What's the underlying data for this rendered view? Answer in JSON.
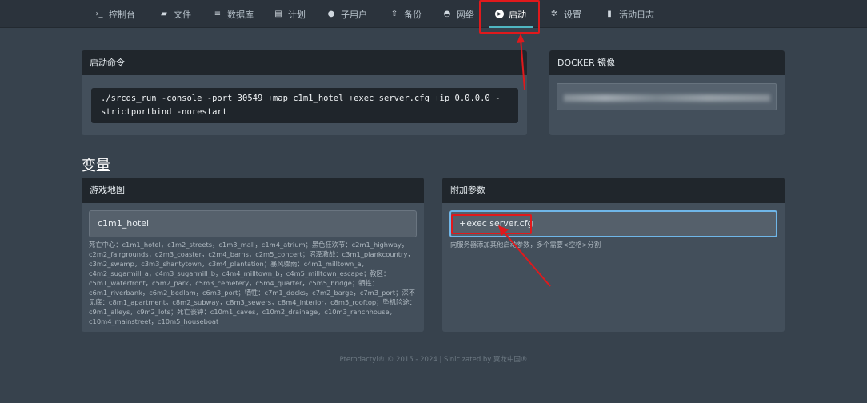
{
  "nav": {
    "items": [
      {
        "icon": "terminal-icon",
        "glyph": "›_",
        "label": "控制台"
      },
      {
        "icon": "folder-icon",
        "glyph": "▰",
        "label": "文件"
      },
      {
        "icon": "database-icon",
        "glyph": "≡",
        "label": "数据库"
      },
      {
        "icon": "calendar-icon",
        "glyph": "▤",
        "label": "计划"
      },
      {
        "icon": "users-icon",
        "glyph": "●",
        "label": "子用户"
      },
      {
        "icon": "upload-icon",
        "glyph": "⇧",
        "label": "备份"
      },
      {
        "icon": "network-icon",
        "glyph": "◓",
        "label": "网络"
      },
      {
        "icon": "play-circle-icon",
        "glyph": "▶",
        "label": "启动"
      },
      {
        "icon": "cogs-icon",
        "glyph": "✲",
        "label": "设置"
      },
      {
        "icon": "book-icon",
        "glyph": "▮",
        "label": "活动日志"
      }
    ],
    "active_index": 7
  },
  "startup": {
    "title": "启动命令",
    "command": "./srcds_run -console -port 30549 +map c1m1_hotel +exec server.cfg +ip 0.0.0.0 -strictportbind -norestart"
  },
  "docker": {
    "title": "DOCKER 镜像"
  },
  "variables": {
    "title": "变量",
    "map": {
      "title": "游戏地图",
      "value": "c1m1_hotel",
      "help": "死亡中心：c1m1_hotel，c1m2_streets，c1m3_mall，c1m4_atrium；黑色狂欢节：c2m1_highway，c2m2_fairgrounds，c2m3_coaster，c2m4_barns，c2m5_concert；沼泽激战：c3m1_plankcountry，c3m2_swamp，c3m3_shantytown，c3m4_plantation；暴风骤雨：c4m1_milltown_a，c4m2_sugarmill_a，c4m3_sugarmill_b，c4m4_milltown_b，c4m5_milltown_escape；教区：c5m1_waterfront，c5m2_park，c5m3_cemetery，c5m4_quarter，c5m5_bridge；牺牲：c6m1_riverbank，c6m2_bedlam，c6m3_port；牺牲：c7m1_docks，c7m2_barge，c7m3_port；深不见底：c8m1_apartment，c8m2_subway，c8m3_sewers，c8m4_interior，c8m5_rooftop；坠机险途：c9m1_alleys，c9m2_lots；死亡丧钟：c10m1_caves，c10m2_drainage，c10m3_ranchhouse，c10m4_mainstreet，c10m5_houseboat"
    },
    "params": {
      "title": "附加参数",
      "value": "+exec server.cfg",
      "help": "向服务器添加其他启动参数，多个需要<空格>分割"
    }
  },
  "footer": "Pterodactyl® © 2015 - 2024 | Sinicizated by 翼龙中国®",
  "colors": {
    "annotation": "#e0191c",
    "focus_border": "#6fb6e8",
    "active_underline": "#4fb6c2"
  }
}
